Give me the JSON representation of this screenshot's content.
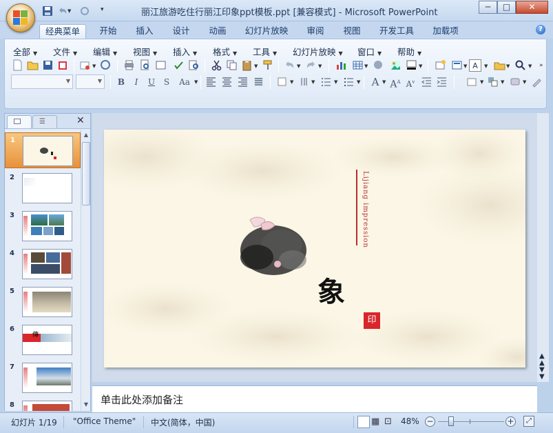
{
  "window": {
    "title": "丽江旅游吃住行丽江印象ppt模板.ppt [兼容模式] - Microsoft PowerPoint",
    "minimize_label": "─",
    "maximize_label": "□",
    "close_label": "✕"
  },
  "ribbon_tabs": [
    {
      "label": "经典菜单",
      "active": true
    },
    {
      "label": "开始"
    },
    {
      "label": "插入"
    },
    {
      "label": "设计"
    },
    {
      "label": "动画"
    },
    {
      "label": "幻灯片放映"
    },
    {
      "label": "审阅"
    },
    {
      "label": "视图"
    },
    {
      "label": "开发工具"
    },
    {
      "label": "加载项"
    }
  ],
  "help_label": "?",
  "menus": [
    {
      "label": "全部"
    },
    {
      "label": "文件"
    },
    {
      "label": "编辑"
    },
    {
      "label": "视图"
    },
    {
      "label": "插入"
    },
    {
      "label": "格式"
    },
    {
      "label": "工具"
    },
    {
      "label": "幻灯片放映"
    },
    {
      "label": "窗口"
    },
    {
      "label": "帮助"
    }
  ],
  "format_buttons": {
    "bold": "B",
    "italic": "I",
    "underline": "U",
    "strike": "S",
    "case": "Aa"
  },
  "slide": {
    "vertical_text": "Lijiang impression",
    "calligraphy": "象",
    "seal": "印"
  },
  "thumbnails": [
    {
      "num": "1"
    },
    {
      "num": "2"
    },
    {
      "num": "3"
    },
    {
      "num": "4"
    },
    {
      "num": "5"
    },
    {
      "num": "6"
    },
    {
      "num": "7"
    },
    {
      "num": "8"
    }
  ],
  "notes_placeholder": "单击此处添加备注",
  "status": {
    "slide_counter": "幻灯片 1/19",
    "theme": "\"Office Theme\"",
    "language": "中文(简体，中国)",
    "zoom": "48%"
  },
  "colors": {
    "accent_red": "#d9262b",
    "ribbon_blue": "#c4d7ef",
    "selected_thumb": "#e8913b"
  }
}
